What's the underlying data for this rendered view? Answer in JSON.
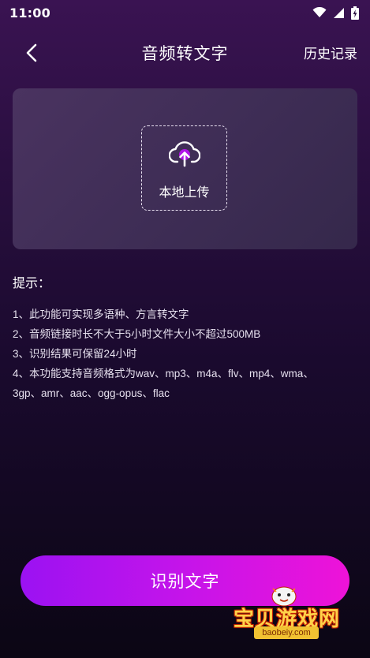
{
  "status_bar": {
    "time": "11:00",
    "icons": [
      "wifi-icon",
      "signal-icon",
      "battery-charging-icon"
    ]
  },
  "nav": {
    "back_icon": "chevron-left-icon",
    "title": "音频转文字",
    "history_label": "历史记录"
  },
  "upload": {
    "icon": "cloud-upload-icon",
    "label": "本地上传"
  },
  "tips": {
    "title": "提示：",
    "items": [
      "1、此功能可实现多语种、方言转文字",
      "2、音频链接时长不大于5小时文件大小不超过500MB",
      "3、识别结果可保留24小时",
      "4、本功能支持音频格式为wav、mp3、m4a、flv、mp4、wma、",
      "3gp、amr、aac、ogg-opus、flac"
    ]
  },
  "action": {
    "label": "识别文字"
  },
  "watermark": {
    "text": "宝贝游戏网",
    "url": "baobeiy.com"
  },
  "colors": {
    "accent_start": "#9b12f2",
    "accent_end": "#ee13d8",
    "background_top": "#3a1352",
    "background_bottom": "#0b0614"
  }
}
